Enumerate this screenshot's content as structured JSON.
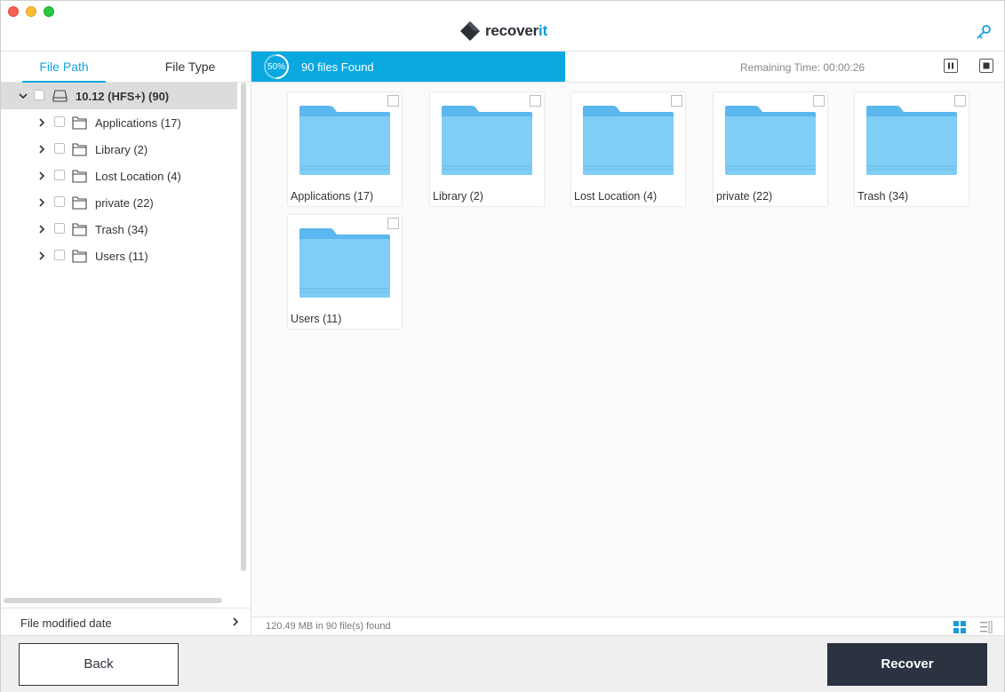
{
  "app": {
    "brand_main": "recover",
    "brand_accent": "it",
    "accent_color": "#09a8e0",
    "icons": {
      "settings": "key-icon"
    }
  },
  "sidebar": {
    "tabs": [
      {
        "label": "File Path",
        "active": true
      },
      {
        "label": "File Type",
        "active": false
      }
    ],
    "root": {
      "label": "10.12 (HFS+) (90)",
      "expanded": true,
      "icon": "drive-icon"
    },
    "items": [
      {
        "label": "Applications (17)"
      },
      {
        "label": "Library (2)"
      },
      {
        "label": "Lost Location (4)"
      },
      {
        "label": "private (22)"
      },
      {
        "label": "Trash (34)"
      },
      {
        "label": "Users (11)"
      }
    ],
    "filter_label": "File modified date"
  },
  "scan": {
    "percent_label": "50%",
    "progress": 0.5,
    "found_label": "90 files Found",
    "remaining_label": "Remaining Time: 00:00:26"
  },
  "grid": {
    "folders": [
      {
        "label": "Applications (17)"
      },
      {
        "label": "Library (2)"
      },
      {
        "label": "Lost Location (4)"
      },
      {
        "label": "private (22)"
      },
      {
        "label": "Trash (34)"
      },
      {
        "label": "Users (11)"
      }
    ]
  },
  "status": {
    "summary": "120.49 MB in 90 file(s) found"
  },
  "footer": {
    "back_label": "Back",
    "recover_label": "Recover"
  }
}
